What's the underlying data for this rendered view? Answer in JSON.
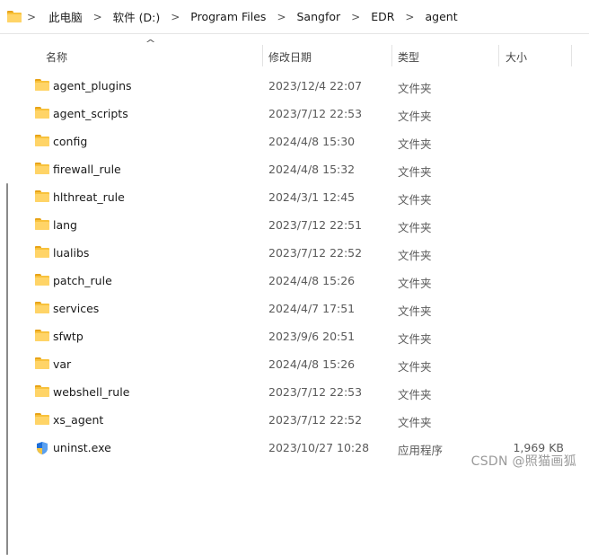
{
  "breadcrumb": [
    "此电脑",
    "软件 (D:)",
    "Program Files",
    "Sangfor",
    "EDR",
    "agent"
  ],
  "columns": {
    "name": "名称",
    "date": "修改日期",
    "type": "类型",
    "size": "大小"
  },
  "files": [
    {
      "name": "agent_plugins",
      "date": "2023/12/4 22:07",
      "type": "文件夹",
      "size": "",
      "icon": "folder-icon"
    },
    {
      "name": "agent_scripts",
      "date": "2023/7/12 22:53",
      "type": "文件夹",
      "size": "",
      "icon": "folder-icon"
    },
    {
      "name": "config",
      "date": "2024/4/8 15:30",
      "type": "文件夹",
      "size": "",
      "icon": "folder-icon"
    },
    {
      "name": "firewall_rule",
      "date": "2024/4/8 15:32",
      "type": "文件夹",
      "size": "",
      "icon": "folder-icon"
    },
    {
      "name": "hlthreat_rule",
      "date": "2024/3/1 12:45",
      "type": "文件夹",
      "size": "",
      "icon": "folder-icon"
    },
    {
      "name": "lang",
      "date": "2023/7/12 22:51",
      "type": "文件夹",
      "size": "",
      "icon": "folder-icon"
    },
    {
      "name": "lualibs",
      "date": "2023/7/12 22:52",
      "type": "文件夹",
      "size": "",
      "icon": "folder-icon"
    },
    {
      "name": "patch_rule",
      "date": "2024/4/8 15:26",
      "type": "文件夹",
      "size": "",
      "icon": "folder-icon"
    },
    {
      "name": "services",
      "date": "2024/4/7 17:51",
      "type": "文件夹",
      "size": "",
      "icon": "folder-icon"
    },
    {
      "name": "sfwtp",
      "date": "2023/9/6 20:51",
      "type": "文件夹",
      "size": "",
      "icon": "folder-icon"
    },
    {
      "name": "var",
      "date": "2024/4/8 15:26",
      "type": "文件夹",
      "size": "",
      "icon": "folder-icon"
    },
    {
      "name": "webshell_rule",
      "date": "2023/7/12 22:53",
      "type": "文件夹",
      "size": "",
      "icon": "folder-icon"
    },
    {
      "name": "xs_agent",
      "date": "2023/7/12 22:52",
      "type": "文件夹",
      "size": "",
      "icon": "folder-icon"
    },
    {
      "name": "uninst.exe",
      "date": "2023/10/27 10:28",
      "type": "应用程序",
      "size": "1,969 KB",
      "icon": "shield-exe-icon"
    }
  ],
  "watermark": "CSDN @照猫画狐",
  "colors": {
    "folder": "#f8c23c",
    "folder_dark": "#e8a317",
    "shield_blue": "#1e6fd9"
  }
}
